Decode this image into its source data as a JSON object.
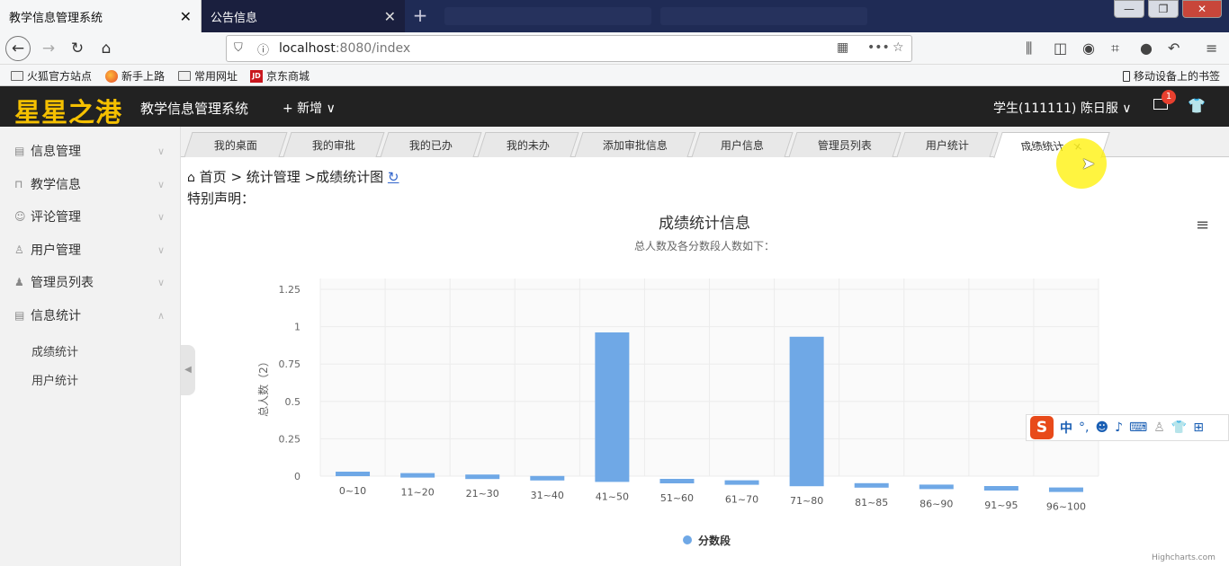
{
  "browser": {
    "tabs": [
      {
        "label": "教学信息管理系统",
        "active": true
      },
      {
        "label": "公告信息",
        "active": false
      }
    ],
    "newtab": "+",
    "close": "✕",
    "window_buttons": [
      "—",
      "❐",
      "✕"
    ],
    "url_host": "localhost",
    "url_path": ":8080/index",
    "bookmarks": [
      "火狐官方站点",
      "新手上路",
      "常用网址",
      "京东商城"
    ],
    "mobile_bookmarks": "移动设备上的书签"
  },
  "app": {
    "logo": "星星之港",
    "name": "教学信息管理系统",
    "new_label": "+ 新增 ∨",
    "user": "学生(111111)  陈日服 ∨",
    "mail_count": "1"
  },
  "sidebar": {
    "items": [
      {
        "label": "信息管理"
      },
      {
        "label": "教学信息"
      },
      {
        "label": "评论管理"
      },
      {
        "label": "用户管理"
      },
      {
        "label": "管理员列表"
      },
      {
        "label": "信息统计"
      }
    ],
    "subitems": [
      "成绩统计",
      "用户统计"
    ]
  },
  "content_tabs": [
    "我的桌面",
    "我的审批",
    "我的已办",
    "我的未办",
    "添加审批信息",
    "用户信息",
    "管理员列表",
    "用户统计",
    "成绩统计"
  ],
  "breadcrumb": {
    "home": "首页",
    "path": " > 统计管理 >成绩统计图",
    "refresh": "↻"
  },
  "notice": "特别声明：",
  "ime": {
    "logo": "S",
    "lang": "中",
    "punct": "°,"
  },
  "chart_data": {
    "type": "bar",
    "title": "成绩统计信息",
    "subtitle": "总人数及各分数段人数如下：",
    "ylabel": "总人数（2）",
    "xlabel": "",
    "categories": [
      "0~10",
      "11~20",
      "21~30",
      "31~40",
      "41~50",
      "51~60",
      "61~70",
      "71~80",
      "81~85",
      "86~90",
      "91~95",
      "96~100"
    ],
    "series": [
      {
        "name": "分数段",
        "values": [
          0,
          0,
          0,
          0,
          1,
          0,
          0,
          1,
          0,
          0,
          0,
          0
        ]
      }
    ],
    "yticks": [
      "0",
      "0.25",
      "0.5",
      "0.75",
      "1",
      "1.25"
    ],
    "ylim": [
      0,
      1.25
    ],
    "grid": true,
    "legend_position": "bottom",
    "bar_color": "#6fa8e6",
    "credit": "Highcharts.com"
  }
}
